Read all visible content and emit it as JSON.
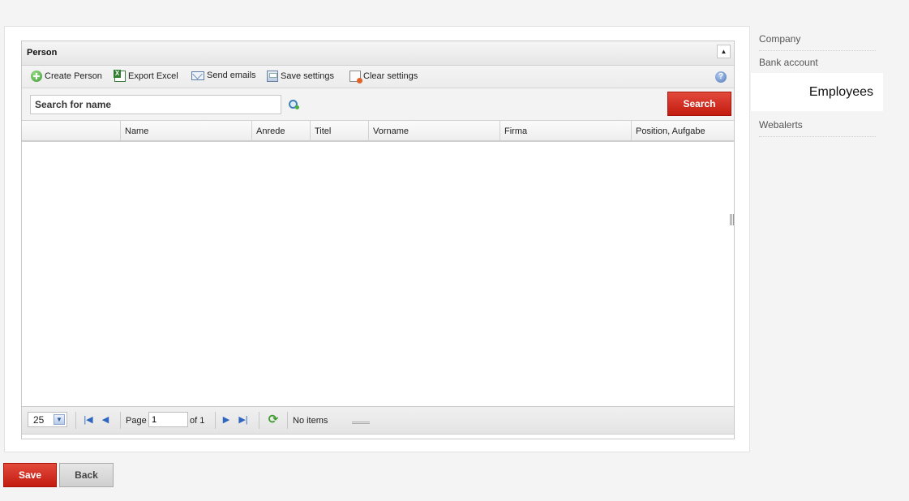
{
  "panel": {
    "title": "Person",
    "collapse_icon": "triangle-up"
  },
  "toolbar": {
    "items": [
      {
        "label": "Create Person",
        "icon": "add-circle-icon"
      },
      {
        "label": "Export Excel",
        "icon": "excel-icon"
      },
      {
        "label": "Send emails",
        "icon": "mail-icon"
      },
      {
        "label": "Save settings",
        "icon": "save-settings-icon"
      },
      {
        "label": "Clear settings",
        "icon": "clear-settings-icon"
      }
    ],
    "help_icon": "?"
  },
  "search": {
    "placeholder": "Search for name",
    "button_label": "Search"
  },
  "grid": {
    "columns": [
      "",
      "Name",
      "Anrede",
      "Titel",
      "Vorname",
      "Firma",
      "Position, Aufgabe"
    ],
    "rows": []
  },
  "pager": {
    "page_size": "25",
    "page_label": "Page",
    "current_page": "1",
    "of_label": "of 1",
    "status": "No items"
  },
  "side_nav": {
    "items": [
      "Company",
      "Bank account",
      "Employees",
      "Webalerts"
    ],
    "active": "Employees"
  },
  "actions": {
    "save_label": "Save",
    "back_label": "Back"
  },
  "colors": {
    "accent": "#c31b10",
    "background": "#f4f4f4"
  }
}
